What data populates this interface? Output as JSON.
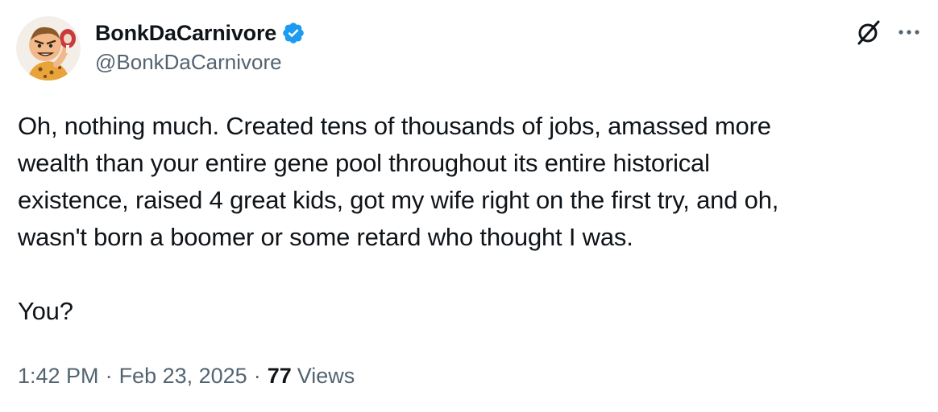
{
  "author": {
    "name": "BonkDaCarnivore",
    "handle": "@BonkDaCarnivore",
    "verified": true,
    "avatar_icon": "caveman-avatar-icon"
  },
  "toolbar": {
    "grok_icon": "grok-icon",
    "more_icon": "more-options-icon"
  },
  "tweet": {
    "text": "Oh, nothing much. Created tens of thousands of jobs, amassed more\nwealth than your entire gene pool throughout its entire historical\nexistence, raised 4 great kids, got my wife right on the first try, and oh,\nwasn't born a boomer or some retard who thought I was.\n\nYou?"
  },
  "meta": {
    "time": "1:42 PM",
    "separator": "·",
    "date": "Feb 23, 2025",
    "views_count": "77",
    "views_label": "Views"
  },
  "colors": {
    "text_primary": "#0f1419",
    "text_secondary": "#536471",
    "verified_blue": "#1d9bf0"
  }
}
